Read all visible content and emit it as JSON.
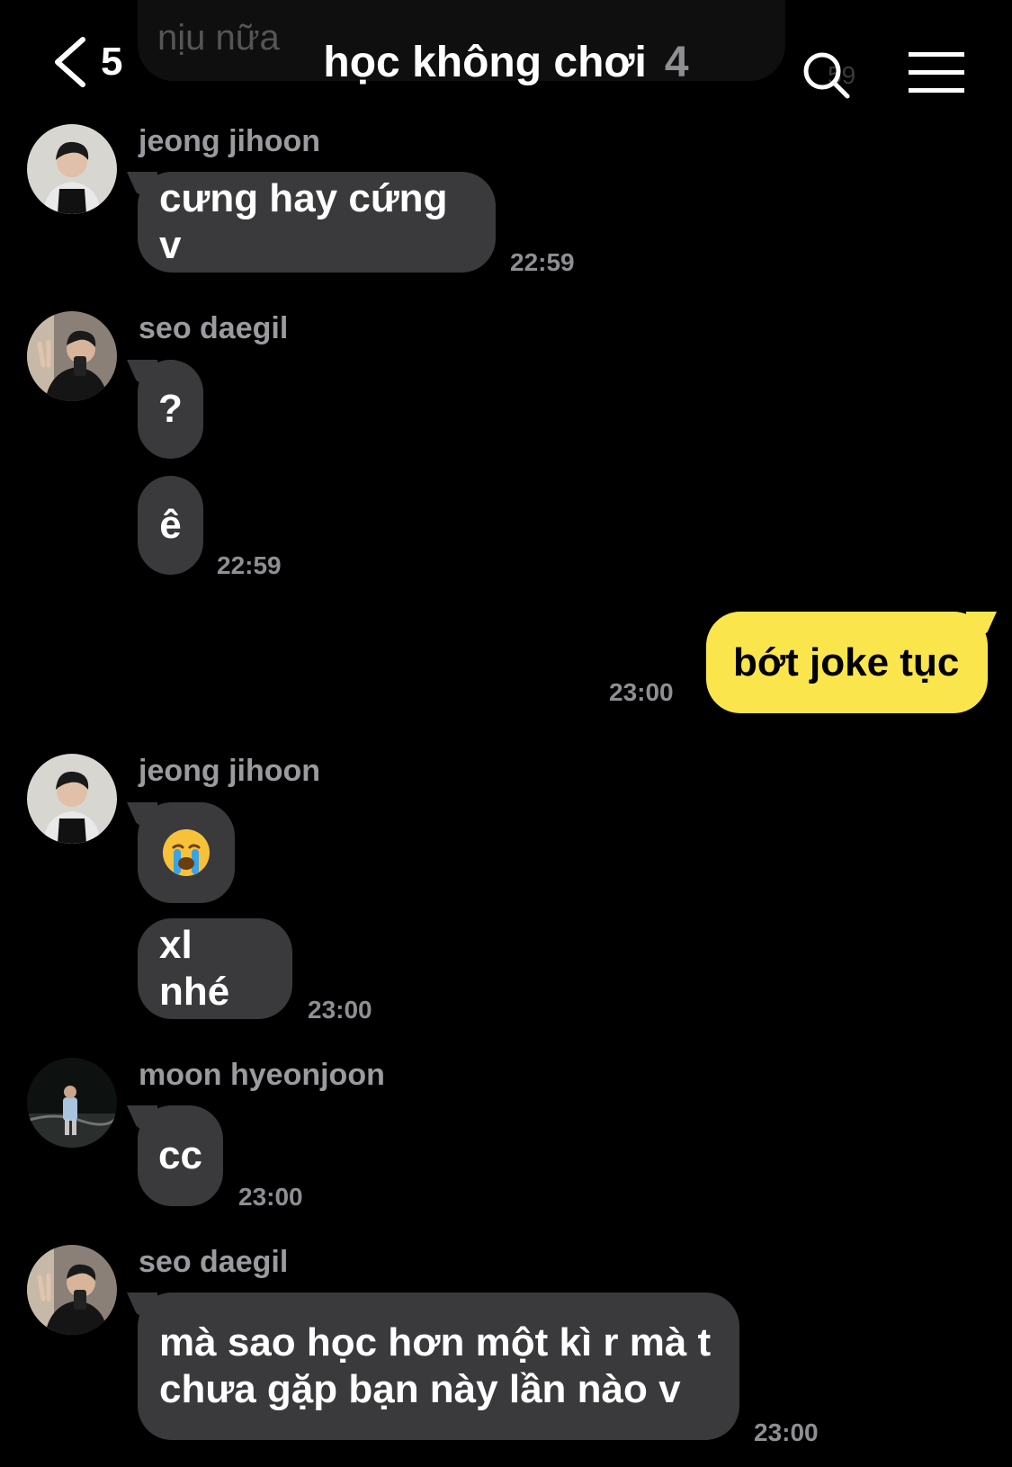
{
  "header": {
    "back_count": "5",
    "title": "học không chơi",
    "member_count": "4",
    "ghost_text": "nịu nữa",
    "ghost_time": "59"
  },
  "messages": [
    {
      "sender": "jeong jihoon",
      "avatar": "jihoon-avatar",
      "bubbles": [
        "cưng hay cứng v"
      ],
      "time": "22:59"
    },
    {
      "sender": "seo daegil",
      "avatar": "daegil-avatar",
      "bubbles": [
        "?",
        "ê"
      ],
      "time": "22:59"
    },
    {
      "sender": "me",
      "bubbles": [
        "bớt joke tục"
      ],
      "time": "23:00"
    },
    {
      "sender": "jeong jihoon",
      "avatar": "jihoon-avatar",
      "bubbles": [
        "😭",
        "xl nhé"
      ],
      "time": "23:00"
    },
    {
      "sender": "moon hyeonjoon",
      "avatar": "hyeonjoon-avatar",
      "bubbles": [
        "cc"
      ],
      "time": "23:00"
    },
    {
      "sender": "seo daegil",
      "avatar": "daegil-avatar",
      "bubbles": [
        "mà sao học hơn một kì r mà t\nchưa gặp bạn này lần nào v"
      ],
      "time": "23:00"
    }
  ],
  "colors": {
    "background": "#000000",
    "other_bubble": "#3a3a3c",
    "my_bubble": "#fae54d",
    "secondary_text": "#8e8e93"
  }
}
